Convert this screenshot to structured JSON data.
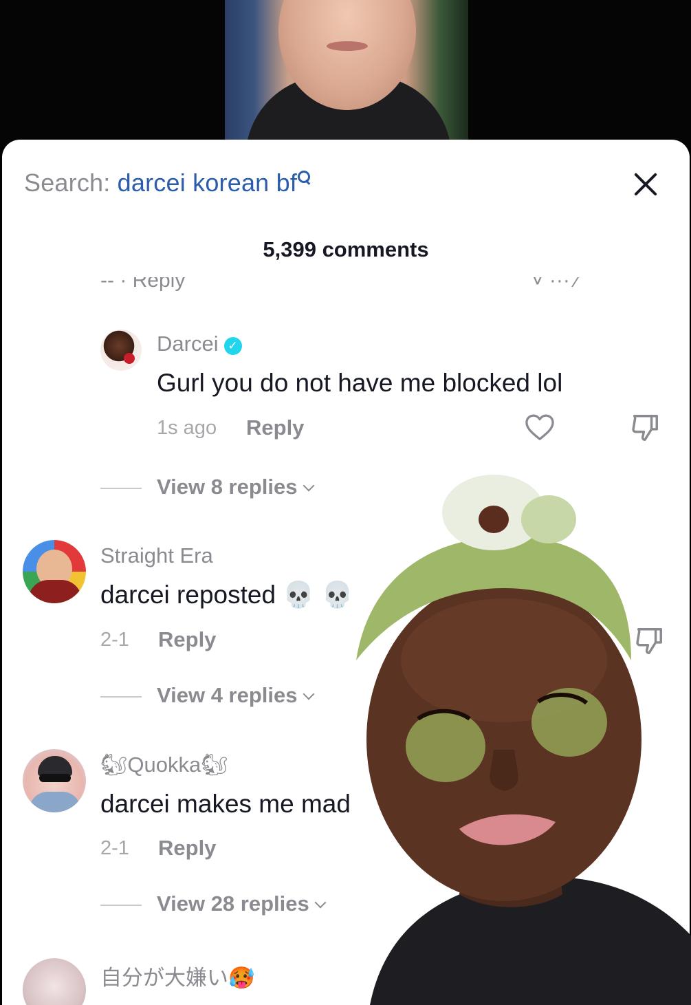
{
  "search": {
    "prefix": "Search: ",
    "term": "darcei korean bf"
  },
  "header": {
    "comments_count": "5,399 comments"
  },
  "partial": {
    "left": "-- · Reply",
    "right": "˅ ···  ⁄"
  },
  "comments": [
    {
      "username": "Darcei",
      "text": "Gurl you do not have me blocked lol",
      "time": "1s ago",
      "reply_label": "Reply",
      "view_replies": "View 8 replies",
      "verified": true
    },
    {
      "username": "Straight Era",
      "text": "darcei reposted 💀 💀",
      "time": "2-1",
      "reply_label": "Reply",
      "view_replies": "View 4 replies"
    },
    {
      "username": "🐿Quokka🐿",
      "text": "darcei makes me mad",
      "time": "2-1",
      "reply_label": "Reply",
      "view_replies": "View 28 replies"
    },
    {
      "username": "自分が大嫌い🥵",
      "text": "",
      "time": "",
      "reply_label": ""
    }
  ],
  "colors": {
    "search_term": "#2b5dac",
    "verified": "#20d5ec",
    "muted": "#8a8b91"
  },
  "icons": [
    "search-icon",
    "close-icon",
    "heart-icon",
    "dislike-icon",
    "chevron-down-icon",
    "verified-icon"
  ]
}
